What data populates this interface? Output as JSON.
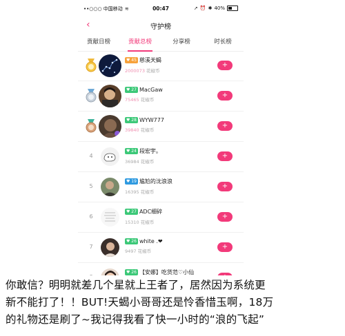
{
  "status_bar": {
    "carrier": "••○○○ 中国移动",
    "time": "00:47",
    "battery": "40%"
  },
  "nav": {
    "back_icon": "‹",
    "title": "守护榜"
  },
  "tabs": [
    {
      "label": "贡献日榜",
      "active": false
    },
    {
      "label": "贡献总榜",
      "active": true
    },
    {
      "label": "分享榜",
      "active": false
    },
    {
      "label": "时长榜",
      "active": false
    }
  ],
  "rows": [
    {
      "rank": "1",
      "medal": "gold-medal-icon",
      "level": "45",
      "level_color": "#f7a23b",
      "name": "慈溪天蝎",
      "amount": "2000073",
      "unit": "花椒币",
      "hot": true
    },
    {
      "rank": "2",
      "medal": "silver-medal-icon",
      "level": "27",
      "level_color": "#3cc878",
      "name": "MacGaw",
      "amount": "75465",
      "unit": "花椒币",
      "hot": true
    },
    {
      "rank": "3",
      "medal": "bronze-medal-icon",
      "level": "28",
      "level_color": "#3cc878",
      "name": "WYW777",
      "amount": "39840",
      "unit": "花椒币",
      "hot": true
    },
    {
      "rank": "4",
      "level": "24",
      "level_color": "#3cc878",
      "name": "段宏宇。",
      "amount": "36984",
      "unit": "花椒币",
      "hot": false
    },
    {
      "rank": "5",
      "level": "19",
      "level_color": "#2f9ae0",
      "name": "尴尬的沈浪浪",
      "amount": "16395",
      "unit": "花椒币",
      "hot": false
    },
    {
      "rank": "6",
      "level": "27",
      "level_color": "#3cc878",
      "name": "ADC细碎",
      "amount": "15310",
      "unit": "花椒币",
      "hot": false
    },
    {
      "rank": "7",
      "level": "26",
      "level_color": "#3cc878",
      "name": "white .❤",
      "amount": "9497",
      "unit": "花椒币",
      "hot": false
    },
    {
      "rank": "8",
      "level": "26",
      "level_color": "#3cc878",
      "name": "【安娜】吃货范♡小仙",
      "amount": "",
      "unit": "",
      "hot": false
    }
  ],
  "add_label": "+",
  "caption": [
    "你敢信？明明就差几个星就上王者了，居然因为系统更",
    "新不能打了！！BUT!天蝎小哥哥还是怜香惜玉啊，18万",
    "的礼物还是刷了~我记得我看了快一小时的“浪的飞起”"
  ]
}
